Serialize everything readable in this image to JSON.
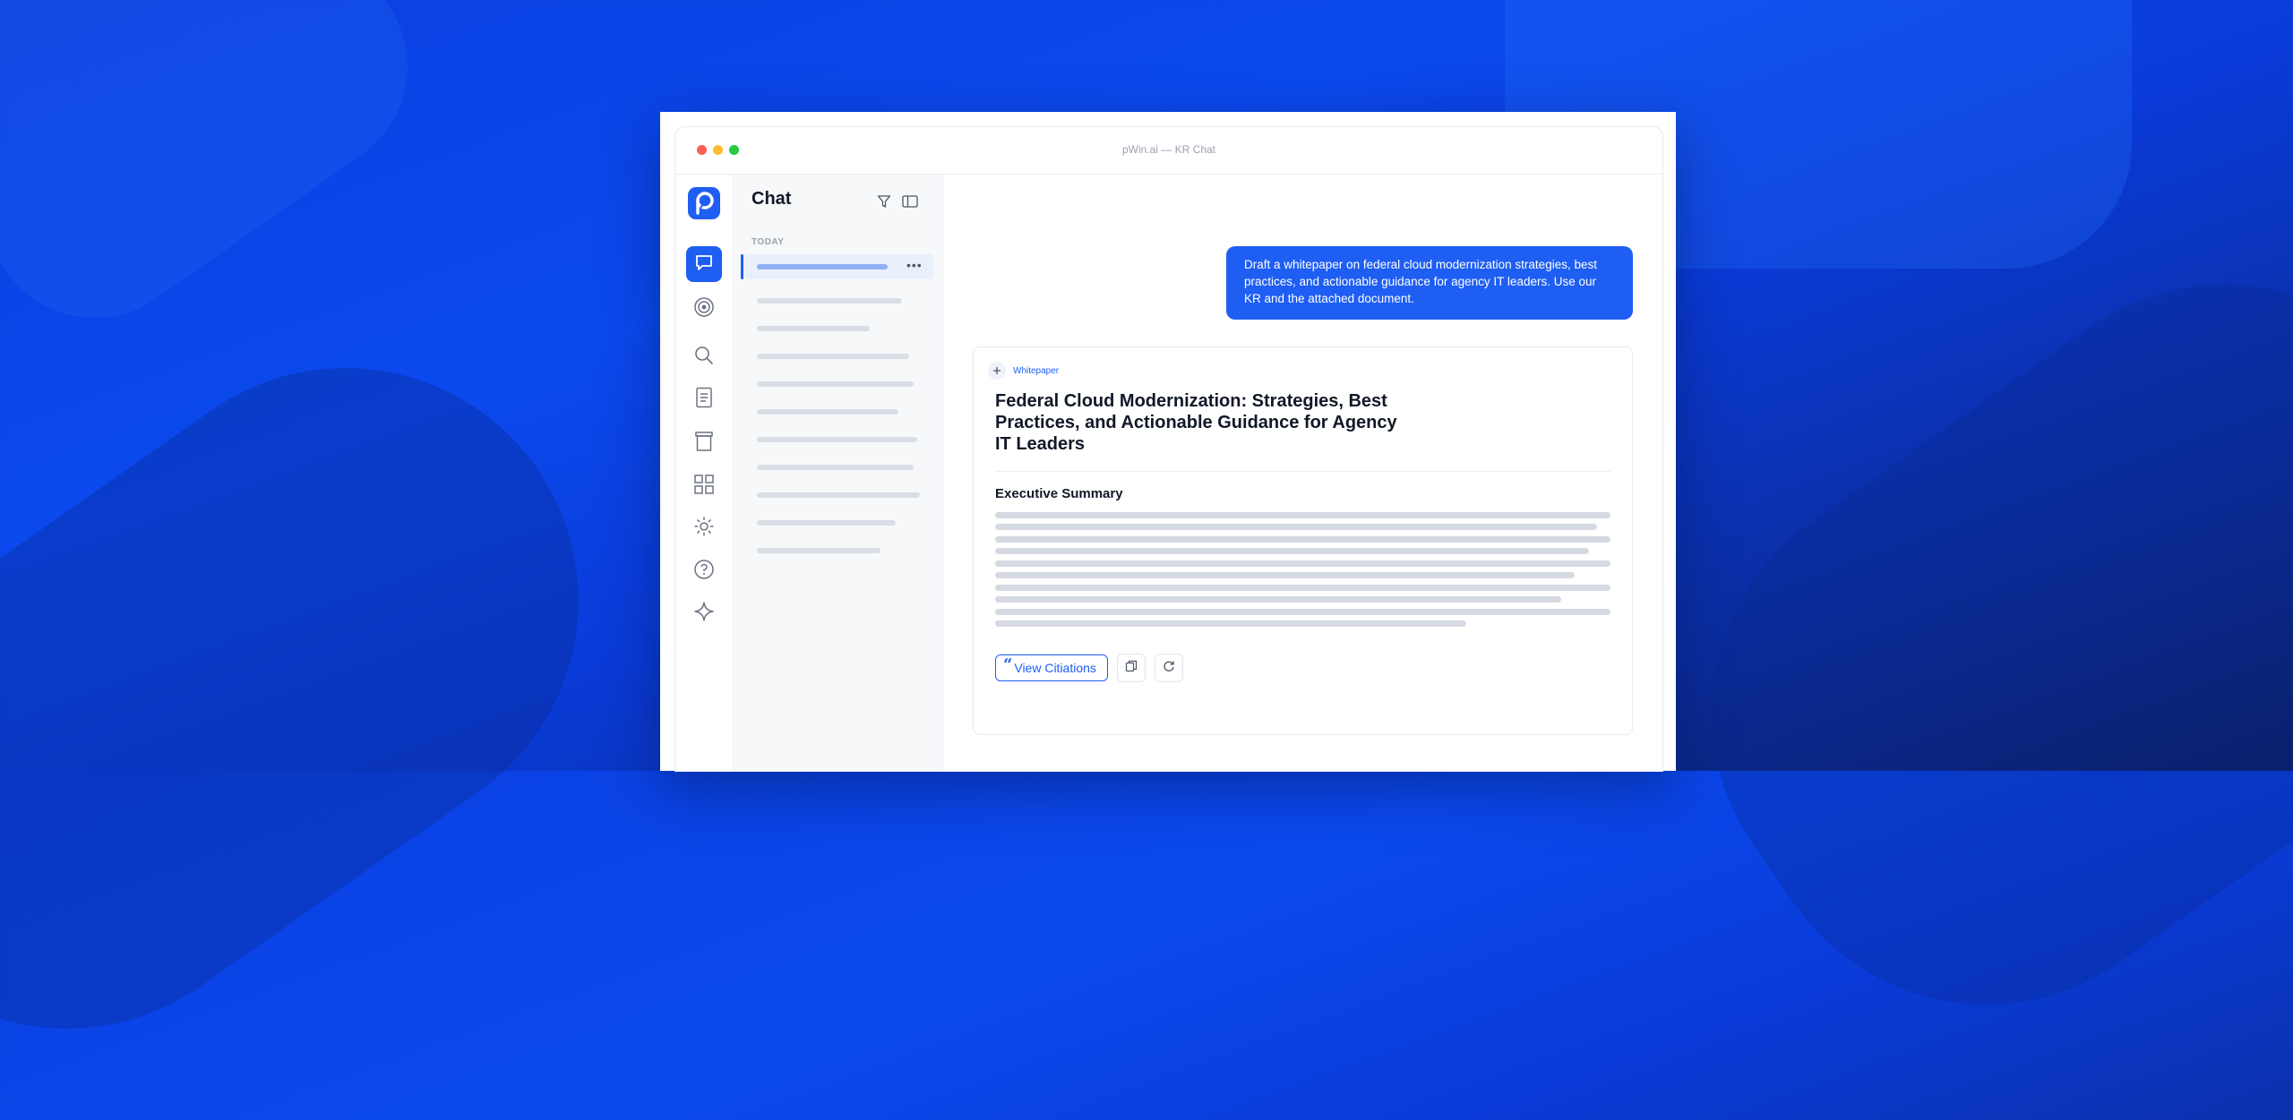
{
  "window": {
    "title": "pWin.ai — KR Chat"
  },
  "rail": {
    "logo": "p-logo",
    "items": [
      {
        "name": "chat",
        "icon": "chat-bubble-icon",
        "active": true
      },
      {
        "name": "target",
        "icon": "target-icon"
      },
      {
        "name": "search",
        "icon": "search-icon"
      },
      {
        "name": "documents",
        "icon": "document-icon"
      },
      {
        "name": "archive",
        "icon": "archive-icon"
      },
      {
        "name": "apps",
        "icon": "grid-icon"
      },
      {
        "name": "settings",
        "icon": "sun-icon"
      },
      {
        "name": "help",
        "icon": "help-icon"
      },
      {
        "name": "ai",
        "icon": "sparkle-icon"
      }
    ]
  },
  "chat_list": {
    "title": "Chat",
    "section": "TODAY",
    "active_more": "•••",
    "icons": [
      "filter-icon",
      "panel-toggle-icon"
    ]
  },
  "message": {
    "user_prompt": "Draft a whitepaper on federal cloud modernization strategies, best practices, and actionable guidance for agency IT leaders. Use our KR and the attached document."
  },
  "response": {
    "tag": "Whitepaper",
    "title": "Federal Cloud Modernization: Strategies, Best Practices, and Actionable Guidance for Agency IT Leaders",
    "section_heading": "Executive Summary",
    "actions": {
      "citations_label": "View Citiations",
      "citations_quote": "“",
      "copy_icon": "copy-icon",
      "regenerate_icon": "refresh-icon"
    }
  },
  "colors": {
    "accent": "#1e5ef3",
    "background": "#0a3fe0"
  }
}
